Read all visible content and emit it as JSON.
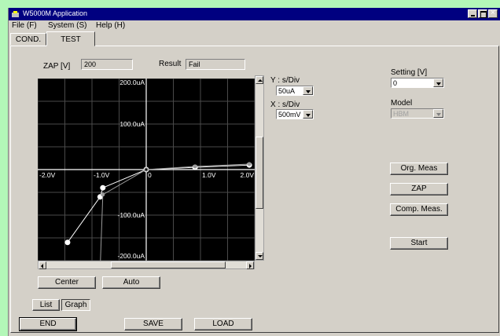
{
  "app": {
    "title": "W5000M Application"
  },
  "menu": {
    "file": "File (F)",
    "system": "System (S)",
    "help": "Help (H)"
  },
  "tabs": [
    {
      "label": "COND."
    },
    {
      "label": "TEST"
    }
  ],
  "zap": {
    "label": "ZAP [V]",
    "value": "200"
  },
  "result": {
    "label": "Result",
    "value": "Fail"
  },
  "y_div": {
    "label": "Y : s/Div",
    "value": "50uA"
  },
  "x_div": {
    "label": "X : s/Div",
    "value": "500mV"
  },
  "setting": {
    "label": "Setting [V]",
    "value": "0"
  },
  "model": {
    "label": "Model",
    "value": "HBM"
  },
  "buttons": {
    "org_meas": "Org. Meas",
    "zap": "ZAP",
    "comp_meas": "Comp. Meas.",
    "start": "Start",
    "center": "Center",
    "auto": "Auto",
    "list": "List",
    "graph": "Graph",
    "end": "END",
    "save": "SAVE",
    "load": "LOAD"
  },
  "chart_data": {
    "type": "line",
    "xlim": [
      -2.0,
      2.0
    ],
    "ylim": [
      -200,
      200
    ],
    "x_ticks": [
      "-2.0V",
      "-1.0V",
      "0",
      "1.0V",
      "2.0V"
    ],
    "y_ticks": [
      "200.0uA",
      "100.0uA",
      "-100.0uA",
      "-200.0uA"
    ],
    "grid": true,
    "series": [
      {
        "x": [
          -1.45,
          -0.85,
          -0.8,
          0.0,
          0.9,
          1.9
        ],
        "y": [
          -160,
          -60,
          -40,
          0,
          5,
          10
        ],
        "style": "white-markers"
      },
      {
        "x": [
          -0.85,
          -0.8,
          0.0,
          0.9,
          1.9
        ],
        "y": [
          -220,
          -55,
          0,
          7,
          12
        ],
        "style": "gray-trace"
      }
    ],
    "colors": {
      "background": "#000000",
      "grid": "#4a4a4a",
      "axis": "#ffffff",
      "trace": "#ffffff"
    }
  }
}
